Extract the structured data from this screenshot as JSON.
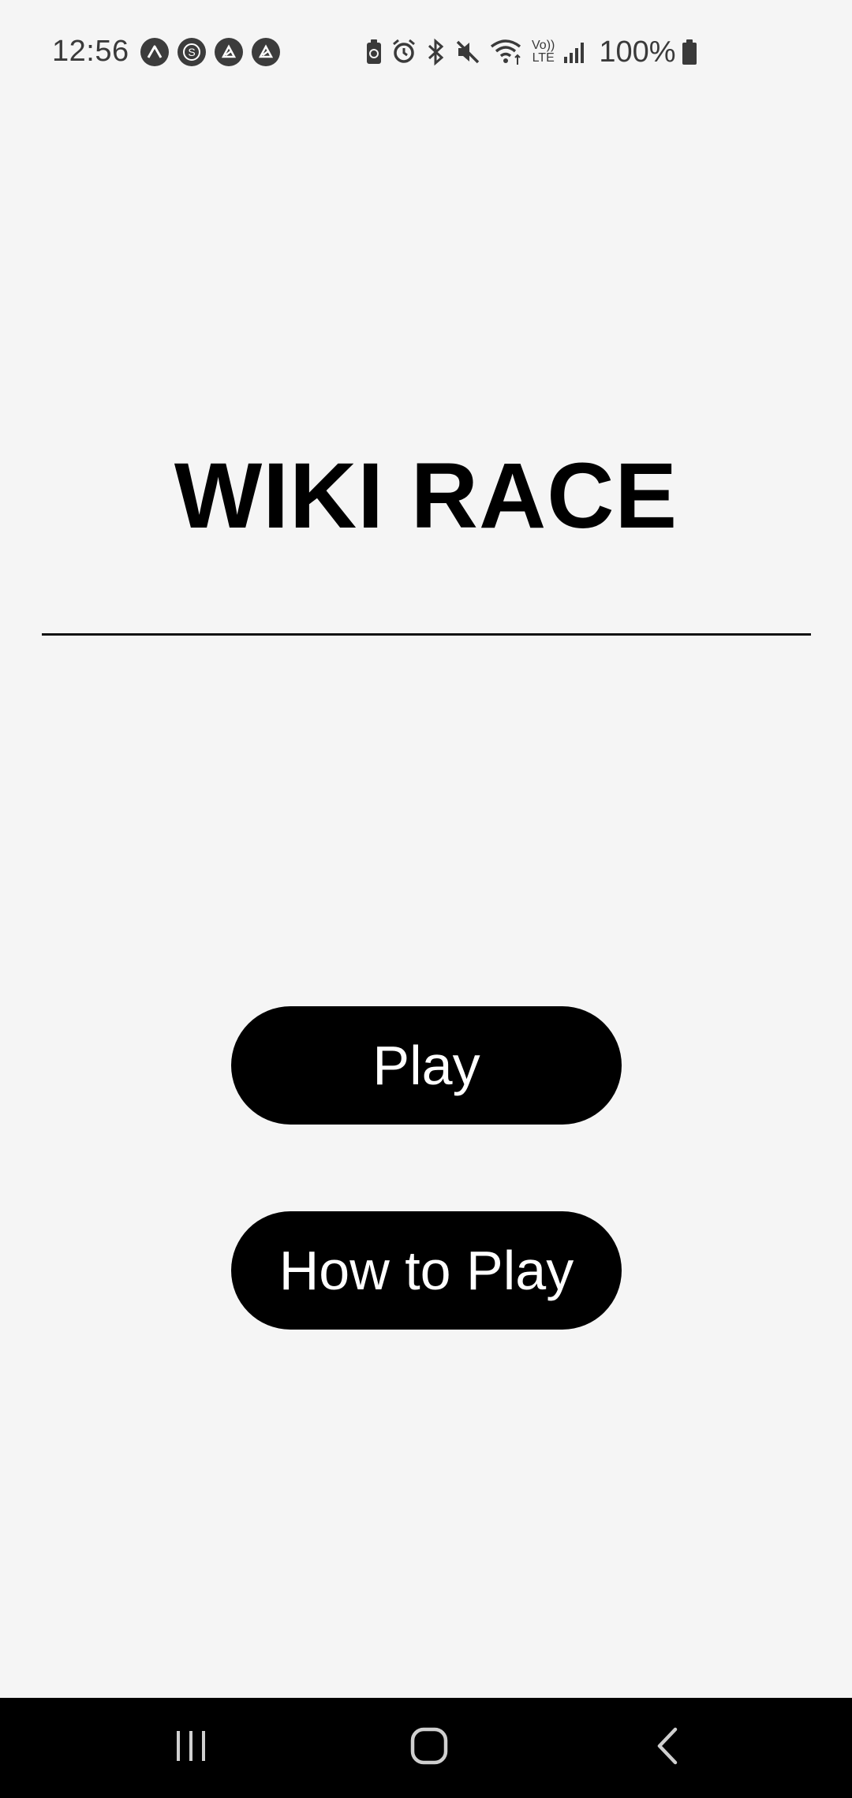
{
  "status_bar": {
    "time": "12:56",
    "battery_percent": "100%",
    "notification_icons": [
      "expo-icon",
      "s-app-icon",
      "news-icon",
      "news-icon-2"
    ],
    "system_icons": [
      "battery-saver-icon",
      "alarm-icon",
      "bluetooth-icon",
      "mute-icon",
      "wifi-icon",
      "volte-icon",
      "signal-icon",
      "battery-icon"
    ],
    "volte_label_top": "Vo))",
    "volte_label_bottom": "LTE"
  },
  "app": {
    "title": "WIKI RACE",
    "play_label": "Play",
    "how_to_play_label": "How to Play"
  },
  "nav_bar": {
    "icons": [
      "recent-apps-icon",
      "home-icon",
      "back-icon"
    ]
  },
  "colors": {
    "background": "#f5f5f5",
    "button_bg": "#000000",
    "button_text": "#ffffff",
    "nav_bg": "#000000"
  }
}
